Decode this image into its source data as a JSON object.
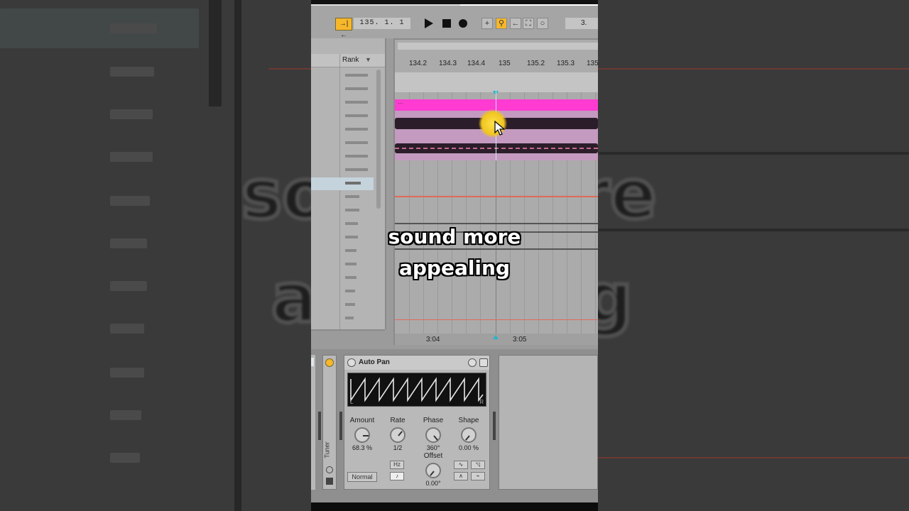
{
  "transport": {
    "follow_glyph": "→|←",
    "position": "135.  1.  1",
    "right_value": "3."
  },
  "browser": {
    "column_header": "Rank",
    "sort_glyph": "▼"
  },
  "ruler": {
    "ticks": [
      "134.2",
      "134.3",
      "134.4",
      "135",
      "135.2",
      "135.3",
      "135"
    ]
  },
  "clip": {
    "label": "..."
  },
  "timeline": {
    "times": [
      "3:04",
      "3:05"
    ]
  },
  "caption": {
    "line1": "sound more",
    "line2": "appealing"
  },
  "tuner": {
    "label": "Tuner"
  },
  "device": {
    "title": "Auto Pan",
    "scope_left": "L",
    "scope_right": "R",
    "params": [
      {
        "name": "Amount",
        "value": "68.3 %"
      },
      {
        "name": "Rate",
        "value": "1/2"
      },
      {
        "name": "Phase",
        "value": "360°"
      },
      {
        "name": "Shape",
        "value": "0.00 %"
      },
      {
        "name": "Offset",
        "value": "0.00°"
      }
    ],
    "hz_label": "Hz",
    "note_label": "♪",
    "mode": "Normal"
  },
  "background_text": {
    "left": "so",
    "left2": "a",
    "right": "re",
    "right2": "g"
  },
  "colors": {
    "accent": "#f7b72b",
    "clip": "#ff3bd1",
    "playhead": "#29b3c4"
  }
}
